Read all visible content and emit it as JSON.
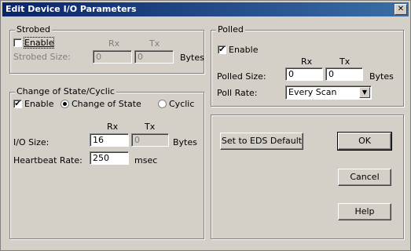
{
  "window": {
    "title": "Edit Device I/O Parameters",
    "close_glyph": "✕"
  },
  "strobed": {
    "title": "Strobed",
    "enable_label": "Enable",
    "enable_checked": false,
    "rx_header": "Rx",
    "tx_header": "Tx",
    "size_label": "Strobed Size:",
    "rx_value": "0",
    "tx_value": "0",
    "units": "Bytes"
  },
  "polled": {
    "title": "Polled",
    "enable_label": "Enable",
    "enable_checked": true,
    "rx_header": "Rx",
    "tx_header": "Tx",
    "size_label": "Polled Size:",
    "rx_value": "0",
    "tx_value": "0",
    "units": "Bytes",
    "rate_label": "Poll Rate:",
    "rate_value": "Every Scan"
  },
  "cos": {
    "title": "Change of State/Cyclic",
    "enable_label": "Enable",
    "enable_checked": true,
    "radio_cos": "Change of State",
    "radio_cyclic": "Cyclic",
    "selected": "Change of State",
    "rx_header": "Rx",
    "tx_header": "Tx",
    "size_label": "I/O Size:",
    "rx_value": "16",
    "tx_value": "0",
    "units": "Bytes",
    "heartbeat_label": "Heartbeat Rate:",
    "heartbeat_value": "250",
    "heartbeat_units": "msec"
  },
  "buttons": {
    "eds_default": "Set to EDS Default",
    "ok": "OK",
    "cancel": "Cancel",
    "help": "Help"
  },
  "icons": {
    "check": "✔",
    "dropdown": "▼"
  }
}
